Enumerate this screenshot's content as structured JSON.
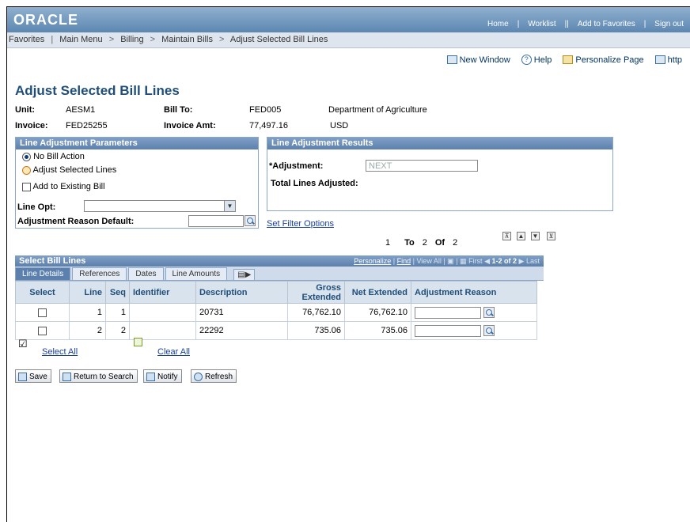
{
  "header": {
    "logo": "ORACLE",
    "links": [
      "Home",
      "Worklist",
      "Add to Favorites",
      "Sign out"
    ]
  },
  "nav": {
    "items": [
      "Favorites",
      "Main Menu",
      "Billing",
      "Maintain Bills",
      "Adjust Selected Bill Lines"
    ]
  },
  "toolbar": {
    "new_window": "New Window",
    "help": "Help",
    "personalize": "Personalize Page",
    "http": "http"
  },
  "page": {
    "title": "Adjust Selected Bill Lines",
    "unit_label": "Unit:",
    "unit_value": "AESM1",
    "bill_to_label": "Bill To:",
    "bill_to_value": "FED005",
    "bill_to_name": "Department of Agriculture",
    "invoice_label": "Invoice:",
    "invoice_value": "FED25255",
    "invoice_amt_label": "Invoice Amt:",
    "invoice_amt_value": "77,497.16",
    "currency": "USD"
  },
  "params": {
    "title": "Line Adjustment Parameters",
    "no_bill_action": "No Bill Action",
    "adjust_selected": "Adjust Selected Lines",
    "add_existing": "Add to Existing Bill",
    "line_opt_label": "Line Opt:",
    "reason_default_label": "Adjustment Reason Default:"
  },
  "results": {
    "title": "Line Adjustment Results",
    "adjustment_label": "*Adjustment:",
    "adjustment_value": "NEXT",
    "total_label": "Total Lines Adjusted:"
  },
  "filter": {
    "set_filter": "Set Filter Options",
    "range_from": "1",
    "to": "To",
    "range_to": "2",
    "of": "Of",
    "total": "2"
  },
  "grid": {
    "title": "Select Bill Lines",
    "personalize": "Personalize",
    "find": "Find",
    "view_all": "View All",
    "first": "First",
    "count": "1-2 of 2",
    "last": "Last",
    "tabs": [
      "Line Details",
      "References",
      "Dates",
      "Line Amounts"
    ],
    "columns": [
      "Select",
      "Line",
      "Seq",
      "Identifier",
      "Description",
      "Gross Extended",
      "Net Extended",
      "Adjustment Reason"
    ],
    "rows": [
      {
        "line": "1",
        "seq": "1",
        "identifier": "",
        "description": "20731",
        "gross": "76,762.10",
        "net": "76,762.10"
      },
      {
        "line": "2",
        "seq": "2",
        "identifier": "",
        "description": "22292",
        "gross": "735.06",
        "net": "735.06"
      }
    ],
    "select_all": "Select All",
    "clear_all": "Clear All"
  },
  "buttons": {
    "save": "Save",
    "return": "Return to Search",
    "notify": "Notify",
    "refresh": "Refresh"
  }
}
